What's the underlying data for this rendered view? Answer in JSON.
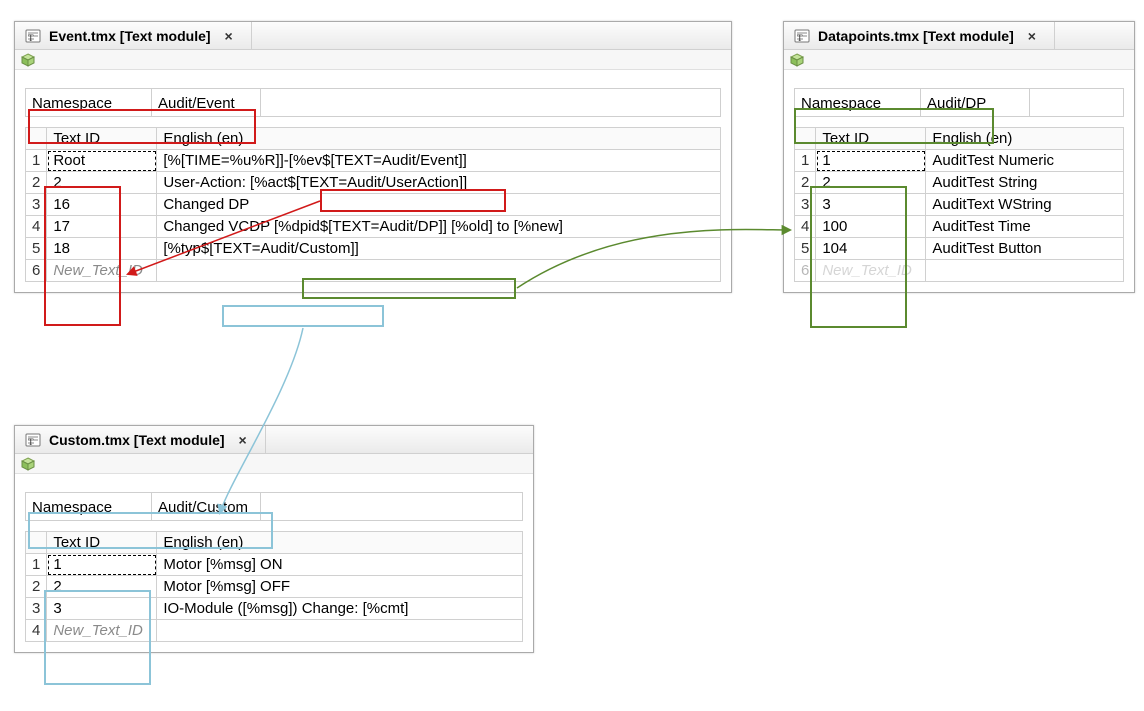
{
  "panels": {
    "event": {
      "title": "Event.tmx [Text module]",
      "namespace_label": "Namespace",
      "namespace_value": "Audit/Event",
      "columns": {
        "id": "Text ID",
        "en": "English (en)"
      },
      "rows": [
        {
          "n": "1",
          "id": "Root",
          "en": "[%[TIME=%u%R]]-[%ev$[TEXT=Audit/Event]]"
        },
        {
          "n": "2",
          "id": "2",
          "en": "User-Action: [%act$[TEXT=Audit/UserAction]]"
        },
        {
          "n": "3",
          "id": "16",
          "en": "Changed DP"
        },
        {
          "n": "4",
          "id": "17",
          "en": "Changed VCDP [%dpid$[TEXT=Audit/DP]] [%old] to [%new]"
        },
        {
          "n": "5",
          "id": "18",
          "en": "[%typ$[TEXT=Audit/Custom]]"
        },
        {
          "n": "6",
          "id": "New_Text_ID",
          "en": ""
        }
      ]
    },
    "datapoints": {
      "title": "Datapoints.tmx [Text module]",
      "namespace_label": "Namespace",
      "namespace_value": "Audit/DP",
      "columns": {
        "id": "Text ID",
        "en": "English (en)"
      },
      "rows": [
        {
          "n": "1",
          "id": "1",
          "en": "AuditTest Numeric"
        },
        {
          "n": "2",
          "id": "2",
          "en": "AuditTest String"
        },
        {
          "n": "3",
          "id": "3",
          "en": "AuditText WString"
        },
        {
          "n": "4",
          "id": "100",
          "en": "AuditTest Time"
        },
        {
          "n": "5",
          "id": "104",
          "en": "AuditTest Button"
        },
        {
          "n": "6",
          "id": "New_Text_ID",
          "en": ""
        }
      ]
    },
    "custom": {
      "title": "Custom.tmx [Text module]",
      "namespace_label": "Namespace",
      "namespace_value": "Audit/Custom",
      "columns": {
        "id": "Text ID",
        "en": "English (en)"
      },
      "rows": [
        {
          "n": "1",
          "id": "1",
          "en": "Motor [%msg] ON"
        },
        {
          "n": "2",
          "id": "2",
          "en": "Motor [%msg] OFF"
        },
        {
          "n": "3",
          "id": "3",
          "en": "IO-Module ([%msg]) Change: [%cmt]"
        },
        {
          "n": "4",
          "id": "New_Text_ID",
          "en": ""
        }
      ]
    }
  },
  "close_glyph": "×"
}
